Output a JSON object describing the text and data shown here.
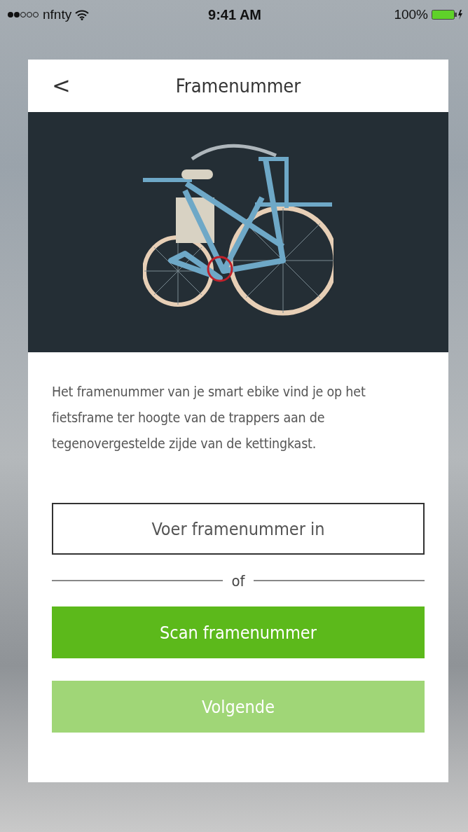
{
  "status_bar": {
    "carrier": "nfnty",
    "time": "9:41 AM",
    "battery": "100%"
  },
  "header": {
    "back": "<",
    "title": "Framenummer"
  },
  "photo": {
    "highlighted": true
  },
  "description": "Het framenummer van je smart ebike vind je op het fietsframe ter hoogte van de trappers aan de tegenovergestelde zijde van de kettingkast.",
  "input": {
    "placeholder": "Voer framenummer in"
  },
  "separator": "of",
  "buttons": [
    {
      "label": "Scan framenummer",
      "disabled": false
    },
    {
      "label": "Volgende",
      "disabled": true
    }
  ]
}
